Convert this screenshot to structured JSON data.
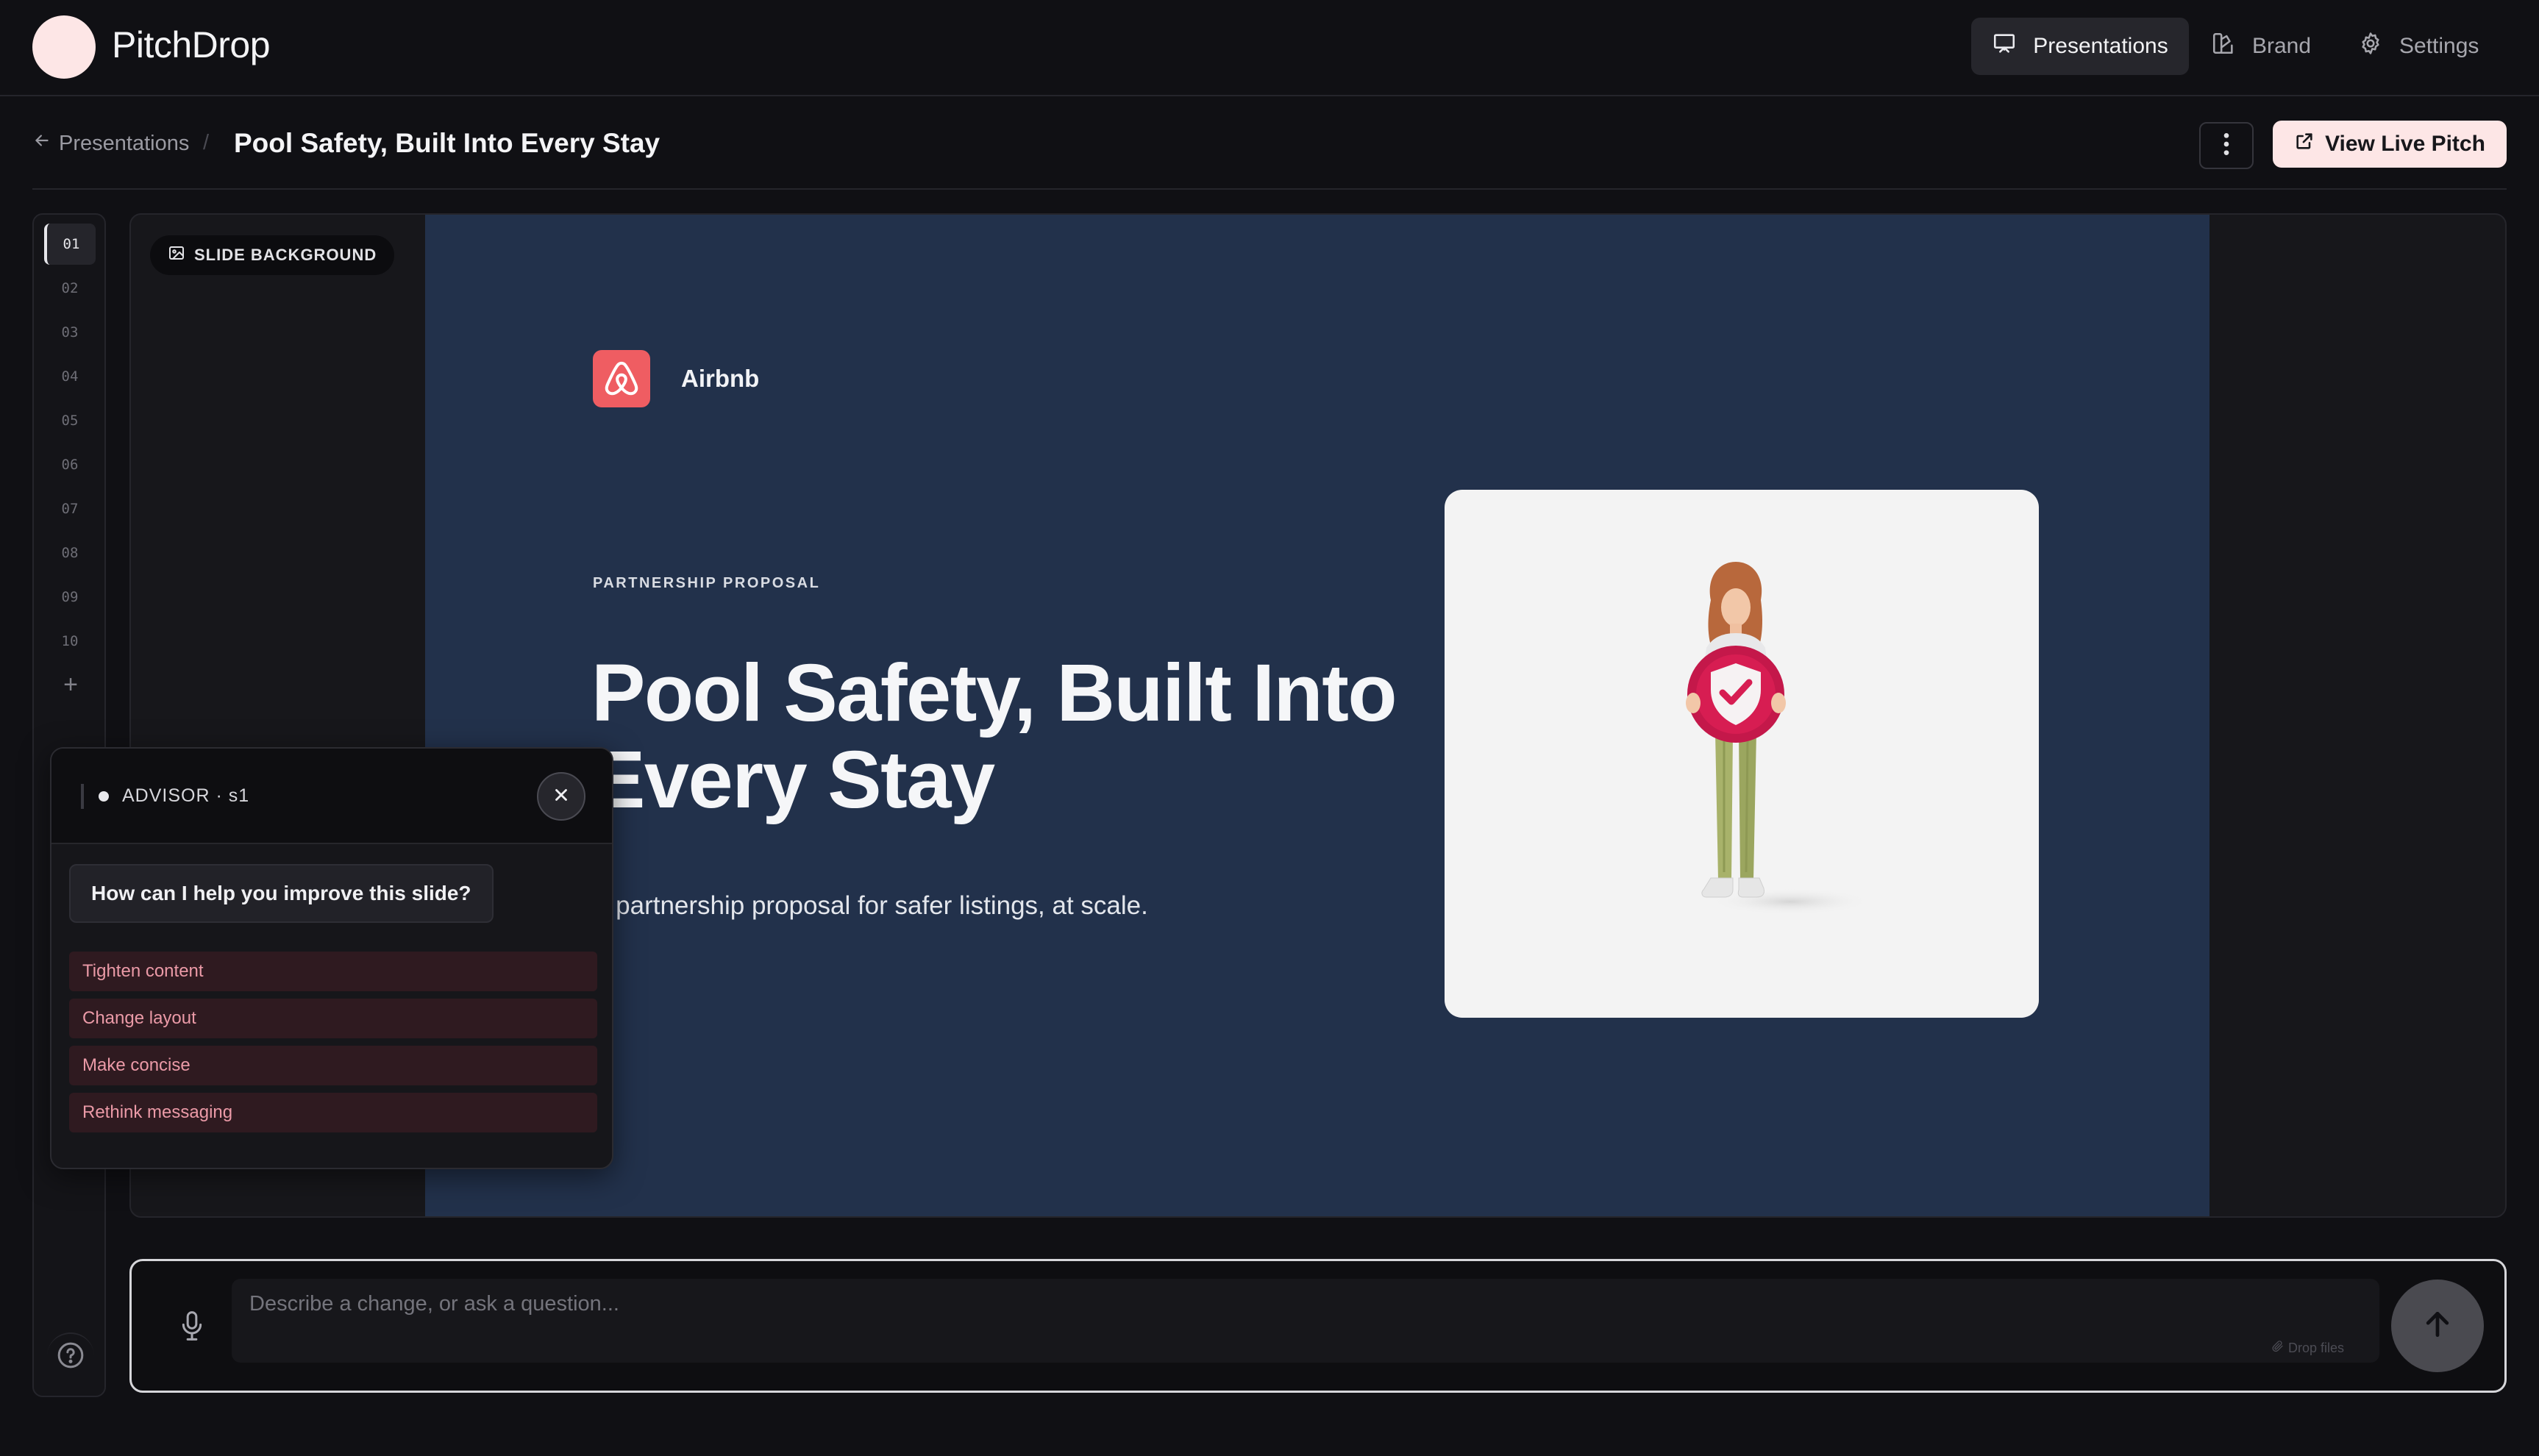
{
  "app": {
    "name": "PitchDrop"
  },
  "nav": {
    "presentations": "Presentations",
    "brand": "Brand",
    "settings": "Settings"
  },
  "header": {
    "back_label": "Presentations",
    "separator": "/",
    "deck_title": "Pool Safety, Built Into Every Stay",
    "live_button": "View Live Pitch"
  },
  "rail": {
    "slides": [
      "01",
      "02",
      "03",
      "04",
      "05",
      "06",
      "07",
      "08",
      "09",
      "10"
    ],
    "active_index": 0,
    "add_label": "+"
  },
  "canvas": {
    "bg_chip": "SLIDE BACKGROUND",
    "slide": {
      "company": "Airbnb",
      "eyebrow": "PARTNERSHIP PROPOSAL",
      "headline_line1": "Pool Safety, Built Into",
      "headline_line2": "Every Stay",
      "subtitle": "A partnership proposal for safer listings, at scale.",
      "background": "#22314b",
      "brand_color": "#ef5d62"
    }
  },
  "advisor": {
    "title": "ADVISOR · s1",
    "question": "How can I help you improve this slide?",
    "suggestions": [
      "Tighten content",
      "Change layout",
      "Make concise",
      "Rethink messaging"
    ]
  },
  "composer": {
    "placeholder": "Describe a change, or ask a question...",
    "drop_hint": "Drop files"
  },
  "icons": {
    "nav_presentations": "presentation-board-icon",
    "nav_brand": "palette-icon",
    "nav_settings": "gear-icon",
    "back": "arrow-left-icon",
    "more": "kebab-icon",
    "live": "external-link-icon",
    "help": "help-circle-icon",
    "chip": "image-icon",
    "close": "close-icon",
    "mic": "microphone-icon",
    "send": "arrow-up-icon"
  }
}
